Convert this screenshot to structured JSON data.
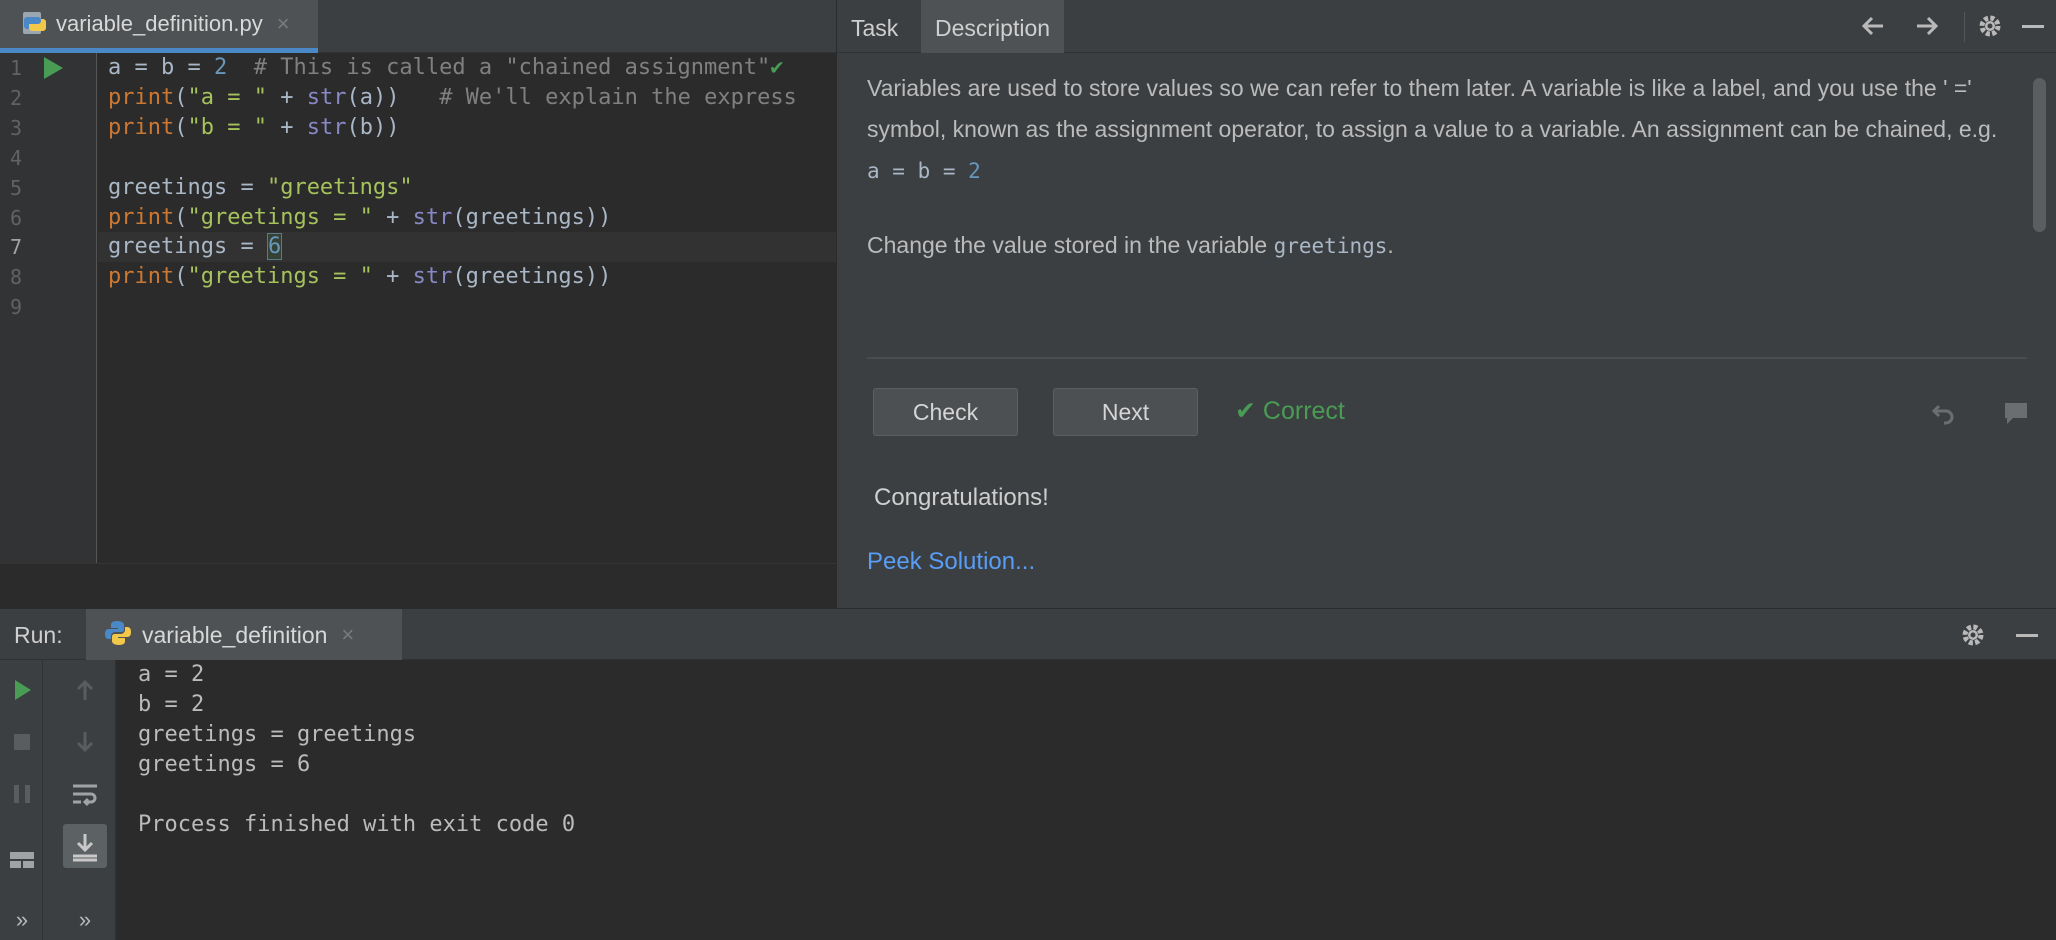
{
  "editor": {
    "file_tab": {
      "label": "variable_definition.py",
      "close": "×"
    },
    "line_numbers": [
      "1",
      "2",
      "3",
      "4",
      "5",
      "6",
      "7",
      "8",
      "9"
    ],
    "current_line": "7",
    "code_lines": [
      {
        "tokens": [
          {
            "t": "a = b = ",
            "c": "plain"
          },
          {
            "t": "2",
            "c": "num"
          },
          {
            "t": "  # This is called a \"chained assignment\"",
            "c": "cmt"
          },
          {
            "t": "✔",
            "c": "checkmark"
          }
        ]
      },
      {
        "tokens": [
          {
            "t": "print",
            "c": "kw-fn"
          },
          {
            "t": "(",
            "c": "plain"
          },
          {
            "t": "\"a = \"",
            "c": "str"
          },
          {
            "t": " + ",
            "c": "plain"
          },
          {
            "t": "str",
            "c": "bi"
          },
          {
            "t": "(a))",
            "c": "plain"
          },
          {
            "t": "   # We'll explain the express",
            "c": "cmt"
          }
        ]
      },
      {
        "tokens": [
          {
            "t": "print",
            "c": "kw-fn"
          },
          {
            "t": "(",
            "c": "plain"
          },
          {
            "t": "\"b = \"",
            "c": "str"
          },
          {
            "t": " + ",
            "c": "plain"
          },
          {
            "t": "str",
            "c": "bi"
          },
          {
            "t": "(b))",
            "c": "plain"
          }
        ]
      },
      {
        "tokens": []
      },
      {
        "tokens": [
          {
            "t": "greetings = ",
            "c": "plain"
          },
          {
            "t": "\"greetings\"",
            "c": "str"
          }
        ]
      },
      {
        "tokens": [
          {
            "t": "print",
            "c": "kw-fn"
          },
          {
            "t": "(",
            "c": "plain"
          },
          {
            "t": "\"greetings = \"",
            "c": "str"
          },
          {
            "t": " + ",
            "c": "plain"
          },
          {
            "t": "str",
            "c": "bi"
          },
          {
            "t": "(greetings))",
            "c": "plain"
          }
        ]
      },
      {
        "tokens": [
          {
            "t": "greetings = ",
            "c": "plain"
          },
          {
            "t": "6",
            "c": "caret-num"
          }
        ]
      },
      {
        "tokens": [
          {
            "t": "print",
            "c": "kw-fn"
          },
          {
            "t": "(",
            "c": "plain"
          },
          {
            "t": "\"greetings = \"",
            "c": "str"
          },
          {
            "t": " + ",
            "c": "plain"
          },
          {
            "t": "str",
            "c": "bi"
          },
          {
            "t": "(greetings))",
            "c": "plain"
          }
        ]
      },
      {
        "tokens": []
      }
    ]
  },
  "task_panel": {
    "tabs": [
      {
        "label": "Task"
      },
      {
        "label": "Description"
      }
    ],
    "icons": [
      "arrow-left-icon",
      "arrow-right-icon",
      "gear-icon",
      "minimize-icon"
    ],
    "description": {
      "p1": "Variables are used to store values so we can refer to them later. A variable is like a label, and you use the ' =' symbol, known as the assignment operator, to assign a value to a variable. An assignment can be chained, e.g.",
      "p1_code_ab": "a = b = ",
      "p1_code_num": "2",
      "p2_before": "Change the value stored in the variable ",
      "p2_code": "greetings",
      "p2_after": "."
    },
    "check_label": "Check",
    "next_label": "Next",
    "status": {
      "icon": "✔",
      "label": "Correct",
      "color": "#499c54"
    },
    "congrats": "Congratulations!",
    "peek_link": "Peek Solution..."
  },
  "run": {
    "title": "Run:",
    "tab": {
      "label": "variable_definition",
      "close": "×"
    },
    "output": [
      "a = 2",
      "b = 2",
      "greetings = greetings",
      "greetings = 6",
      "",
      "Process finished with exit code 0"
    ]
  },
  "colors": {
    "accent": "#4a88c7",
    "run_green": "#499c54",
    "link": "#589df6",
    "string": "#a5c25c",
    "keyword": "#cc7832",
    "number": "#6897bb"
  }
}
